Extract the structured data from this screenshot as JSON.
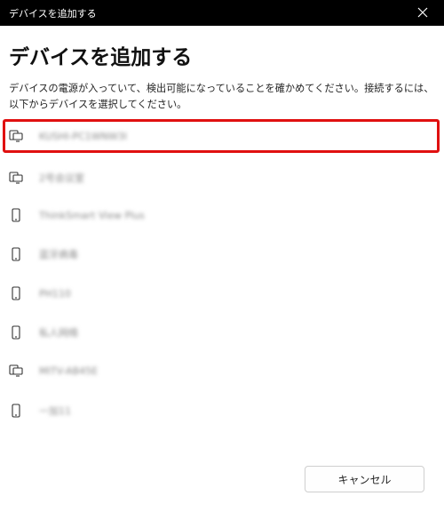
{
  "window": {
    "title": "デバイスを追加する"
  },
  "main": {
    "heading": "デバイスを追加する",
    "description": "デバイスの電源が入っていて、検出可能になっていることを確かめてください。接続するには、以下からデバイスを選択してください。"
  },
  "devices": [
    {
      "name": "KUSHI-PC1WNW3I",
      "icon": "display-device-icon",
      "selected": true
    },
    {
      "name": "2号会议室",
      "icon": "display-device-icon",
      "selected": false
    },
    {
      "name": "ThinkSmart View Plus",
      "icon": "phone-icon",
      "selected": false
    },
    {
      "name": "蓝牙病毒",
      "icon": "phone-icon",
      "selected": false
    },
    {
      "name": "PH110",
      "icon": "phone-icon",
      "selected": false
    },
    {
      "name": "私人网络",
      "icon": "phone-icon",
      "selected": false
    },
    {
      "name": "MITV-AB45E",
      "icon": "display-device-icon",
      "selected": false
    },
    {
      "name": "一加11",
      "icon": "phone-icon",
      "selected": false
    }
  ],
  "footer": {
    "cancel_label": "キャンセル"
  },
  "colors": {
    "titlebar": "#000000",
    "selection_border": "#e01010"
  }
}
